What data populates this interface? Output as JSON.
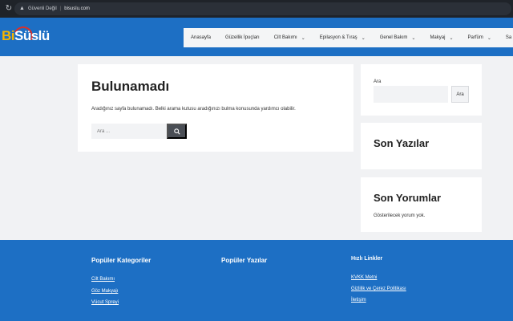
{
  "browser": {
    "security_label": "Güvenli Değil",
    "url": "bisuslu.com"
  },
  "header": {
    "logo_prefix": "Bi",
    "logo_main": "Süslü",
    "nav": [
      {
        "label": "Anasayfa",
        "has_dropdown": false
      },
      {
        "label": "Güzellik İpuçları",
        "has_dropdown": false
      },
      {
        "label": "Cilt Bakımı",
        "has_dropdown": true
      },
      {
        "label": "Epilasyon & Tıraş",
        "has_dropdown": true
      },
      {
        "label": "Genel Bakım",
        "has_dropdown": true
      },
      {
        "label": "Makyaj",
        "has_dropdown": true
      },
      {
        "label": "Parfüm",
        "has_dropdown": true
      },
      {
        "label": "Sa",
        "has_dropdown": false
      }
    ]
  },
  "main": {
    "title": "Bulunamadı",
    "message": "Aradığınız sayfa bulunamadı. Belki arama kutusu aradığınızı bulma konusunda yardımcı olabilir.",
    "search_placeholder": "Ara ..."
  },
  "sidebar": {
    "search_label": "Ara",
    "search_button": "Ara",
    "recent_title": "Son Yazılar",
    "comments_title": "Son Yorumlar",
    "comments_empty": "Gösterilecek yorum yok."
  },
  "footer": {
    "col1_title": "Popüler Kategoriler",
    "col1_links": [
      "Cilt Bakımı",
      "Göz Makyajı",
      "Vücut Spreyi"
    ],
    "col2_title": "Popüler Yazılar",
    "col3_title": "Hızlı Linkler",
    "col3_links": [
      "KVKK Metni",
      "Gizlilik ve Çerez Politikası",
      "İletişim"
    ]
  },
  "colors": {
    "brand_blue": "#1d6fc4",
    "logo_accent": "#f5b400",
    "logo_ring": "#d9312b"
  },
  "icons": [
    "reload-icon",
    "warning-icon",
    "search-icon",
    "chevron-down-icon"
  ]
}
